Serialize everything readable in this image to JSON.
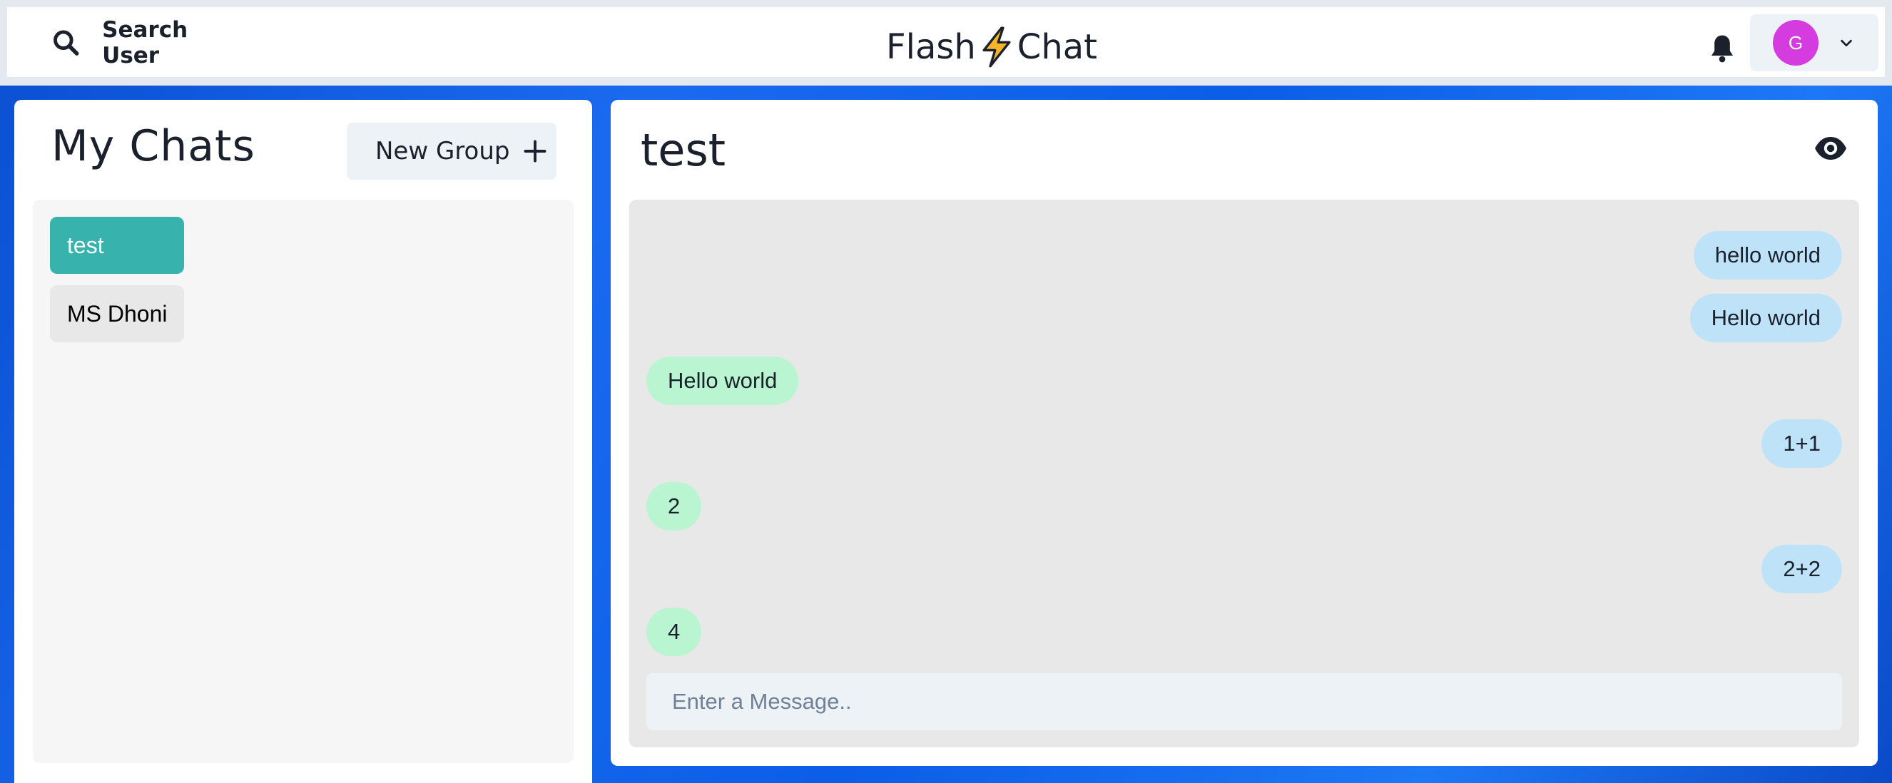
{
  "header": {
    "search_label": "Search User",
    "brand_left": "Flash",
    "brand_right": "Chat",
    "avatar_initial": "G",
    "avatar_color": "#d53cdf"
  },
  "sidebar": {
    "title": "My Chats",
    "new_group_label": "New Group",
    "chats": [
      {
        "name": "test",
        "active": true
      },
      {
        "name": "MS Dhoni",
        "active": false
      }
    ]
  },
  "chat": {
    "title": "test",
    "messages": [
      {
        "text": "hello world",
        "from": "me"
      },
      {
        "text": "Hello world",
        "from": "me"
      },
      {
        "text": "Hello world",
        "from": "other"
      },
      {
        "text": "1+1",
        "from": "me"
      },
      {
        "text": "2",
        "from": "other"
      },
      {
        "text": "2+2",
        "from": "me"
      },
      {
        "text": "4",
        "from": "other"
      }
    ],
    "input_placeholder": "Enter a Message.."
  },
  "colors": {
    "active_chat": "#38b2ac",
    "sent_bubble": "#bee3f8",
    "received_bubble": "#b9f5d0"
  }
}
